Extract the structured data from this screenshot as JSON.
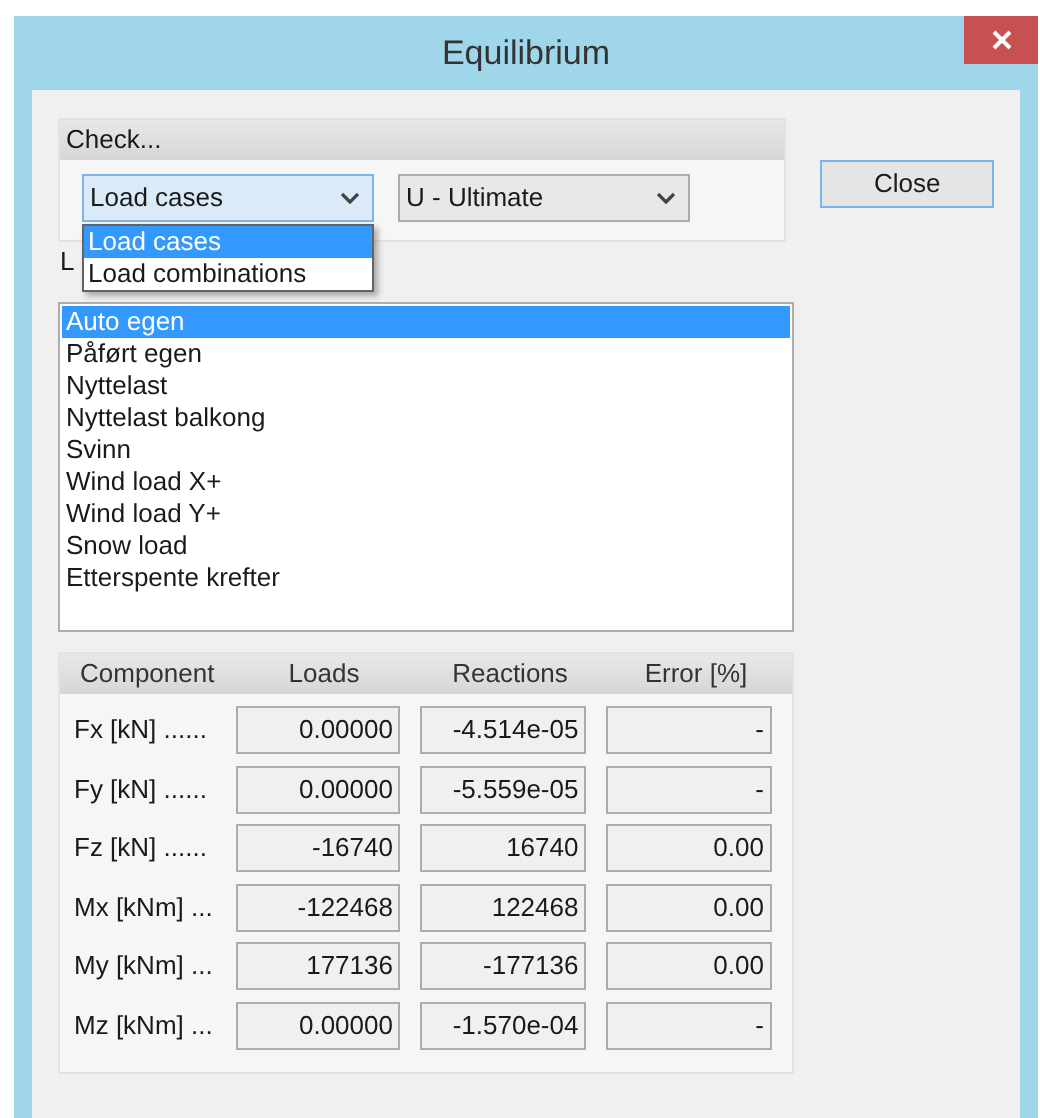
{
  "window": {
    "title": "Equilibrium"
  },
  "check": {
    "title": "Check...",
    "dropdowns": [
      {
        "value": "Load cases",
        "expanded": true,
        "options": [
          {
            "label": "Load cases",
            "selected": true
          },
          {
            "label": "Load combinations",
            "selected": false
          }
        ]
      },
      {
        "value": "U - Ultimate",
        "expanded": false
      }
    ]
  },
  "close_button": "Close",
  "list_label": "L",
  "load_list": [
    {
      "label": "Auto egen",
      "selected": true
    },
    {
      "label": "Påført egen",
      "selected": false
    },
    {
      "label": "Nyttelast",
      "selected": false
    },
    {
      "label": "Nyttelast balkong",
      "selected": false
    },
    {
      "label": "Svinn",
      "selected": false
    },
    {
      "label": "Wind load X+",
      "selected": false
    },
    {
      "label": "Wind load Y+",
      "selected": false
    },
    {
      "label": "Snow load",
      "selected": false
    },
    {
      "label": "Etterspente krefter",
      "selected": false
    }
  ],
  "table": {
    "columns": [
      "Component",
      "Loads",
      "Reactions",
      "Error [%]"
    ],
    "rows": [
      [
        "Fx [kN] ......",
        "0.00000",
        "-4.514e-05",
        "-"
      ],
      [
        "Fy [kN] ......",
        "0.00000",
        "-5.559e-05",
        "-"
      ],
      [
        "Fz [kN] ......",
        "-16740",
        "16740",
        "0.00"
      ],
      [
        "Mx [kNm] ...",
        "-122468",
        "122468",
        "0.00"
      ],
      [
        "My [kNm] ...",
        "177136",
        "-177136",
        "0.00"
      ],
      [
        "Mz [kNm] ...",
        "0.00000",
        "-1.570e-04",
        "-"
      ]
    ]
  }
}
